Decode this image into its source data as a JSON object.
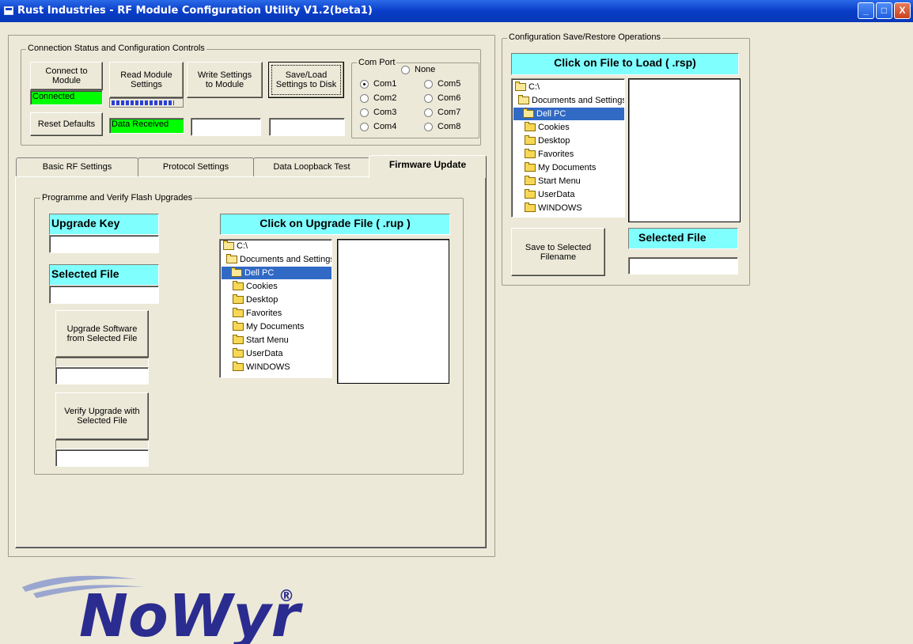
{
  "window": {
    "title": "Rust Industries - RF Module Configuration Utility V1.2(beta1)",
    "controls": [
      "_",
      "□",
      "X"
    ]
  },
  "connection": {
    "group_label": "Connection Status and Configuration Controls",
    "connect_label": "Connect to Module",
    "status": "Connected",
    "read_label": "Read Module Settings",
    "write_label": "Write Settings to Module",
    "saveload_label": "Save/Load Settings to Disk",
    "reset_label": "Reset Defaults",
    "data_status": "Data Received",
    "read_progress_fraction": 0.9,
    "write_status_value": "",
    "saveload_status_value": ""
  },
  "com_port": {
    "group_label": "Com Port",
    "none_label": "None",
    "options": [
      "Com1",
      "Com2",
      "Com3",
      "Com4",
      "Com5",
      "Com6",
      "Com7",
      "Com8"
    ],
    "selected": "Com1"
  },
  "tabs": [
    "Basic RF Settings",
    "Protocol Settings",
    "Data Loopback Test",
    "Firmware Update"
  ],
  "active_tab": "Firmware Update",
  "firmware": {
    "group_label": "Programme and Verify Flash Upgrades",
    "upgrade_key_label": "Upgrade Key",
    "upgrade_key_value": "",
    "selected_file_label": "Selected File",
    "selected_file_value": "",
    "click_upgrade_label": "Click on Upgrade File ( .rup )",
    "upgrade_button": "Upgrade Software from Selected File",
    "upgrade_status": "",
    "verify_button": "Verify  Upgrade with Selected File",
    "verify_status": ""
  },
  "tree": {
    "items": [
      "C:\\",
      "Documents and Settings",
      "Dell PC",
      "Cookies",
      "Desktop",
      "Favorites",
      "My Documents",
      "Start Menu",
      "UserData",
      "WINDOWS"
    ],
    "selected": "Dell PC"
  },
  "config_ops": {
    "group_label": "Configuration Save/Restore Operations",
    "click_load_label": "Click on File to Load ( .rsp)",
    "save_button": "Save to Selected Filename",
    "selected_file_label": "Selected File",
    "selected_file_value": ""
  },
  "logo": {
    "text": "NoWyr",
    "mark": "®",
    "colors": {
      "primary": "#2b2c8f",
      "swoosh": "#9aa6cf"
    }
  },
  "colors": {
    "status_ok": "#00ff00",
    "label_bg": "#80ffff",
    "selection": "#316ac5",
    "window_bg": "#ece9d8",
    "titlebar": "#0a3dc8"
  }
}
